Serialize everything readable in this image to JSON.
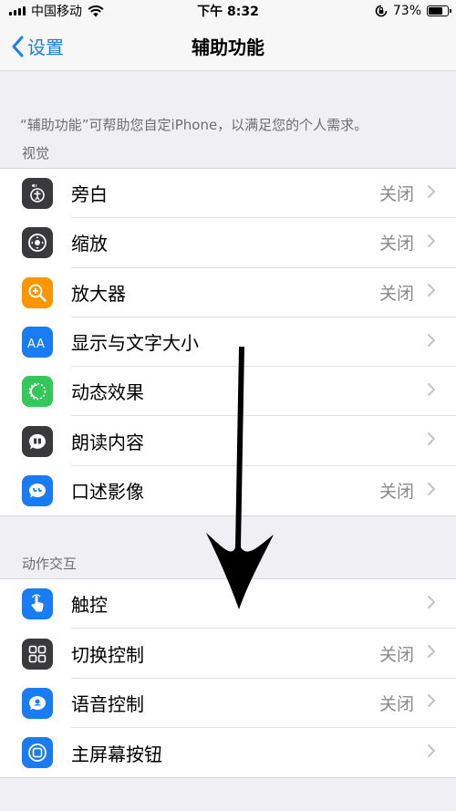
{
  "status_bar": {
    "carrier": "中国移动",
    "time": "下午 8:32",
    "battery_percent": "73%",
    "battery_level": 0.73
  },
  "nav": {
    "back_label": "设置",
    "title": "辅助功能"
  },
  "description": "“辅助功能”可帮助您自定iPhone，以满足您的个人需求。",
  "sections": [
    {
      "header": "视觉",
      "items": [
        {
          "label": "旁白",
          "value": "关闭",
          "icon": "voiceover-icon",
          "color": "#3a3a3c"
        },
        {
          "label": "缩放",
          "value": "关闭",
          "icon": "zoom-icon",
          "color": "#3a3a3c"
        },
        {
          "label": "放大器",
          "value": "关闭",
          "icon": "magnifier-icon",
          "color": "#ff9500"
        },
        {
          "label": "显示与文字大小",
          "value": "",
          "icon": "text-size-icon",
          "color": "#1a7cf5"
        },
        {
          "label": "动态效果",
          "value": "",
          "icon": "motion-icon",
          "color": "#34c759"
        },
        {
          "label": "朗读内容",
          "value": "",
          "icon": "spoken-content-icon",
          "color": "#3a3a3c"
        },
        {
          "label": "口述影像",
          "value": "关闭",
          "icon": "audio-description-icon",
          "color": "#1a7cf5"
        }
      ]
    },
    {
      "header": "动作交互",
      "items": [
        {
          "label": "触控",
          "value": "",
          "icon": "touch-icon",
          "color": "#1a7cf5"
        },
        {
          "label": "切换控制",
          "value": "关闭",
          "icon": "switch-control-icon",
          "color": "#3a3a3c"
        },
        {
          "label": "语音控制",
          "value": "关闭",
          "icon": "voice-control-icon",
          "color": "#1a7cf5"
        },
        {
          "label": "主屏幕按钮",
          "value": "",
          "icon": "home-button-icon",
          "color": "#1a7cf5"
        }
      ]
    }
  ]
}
